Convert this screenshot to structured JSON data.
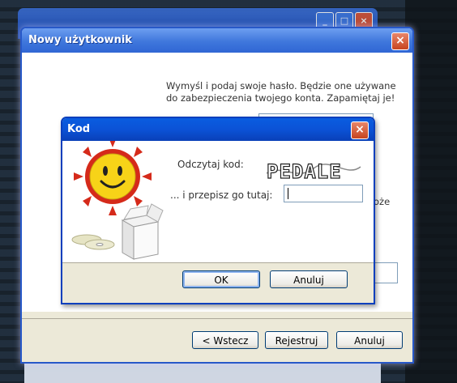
{
  "back_window": {
    "title": ""
  },
  "wizard": {
    "title": "Nowy użytkownik",
    "intro": "Wymyśl i podaj swoje hasło. Będzie one używane do zabezpieczenia twojego konta. Zapamiętaj je!",
    "partial_text_1": "oże",
    "partial_text_2": "e:",
    "back_label": "< Wstecz",
    "register_label": "Rejestruj",
    "cancel_label": "Anuluj"
  },
  "dialog": {
    "title": "Kod",
    "read_code_label": "Odczytaj kod:",
    "captcha_text": "PEDALE",
    "rewrite_label": "... i przepisz go tutaj:",
    "code_value": "",
    "ok_label": "OK",
    "cancel_label": "Anuluj"
  },
  "icons": [
    "sun-smiley-icon",
    "box-icon",
    "cd-icon",
    "close-icon",
    "minimize-icon",
    "maximize-icon"
  ],
  "colors": {
    "titlebar": "#0b52d6",
    "face": "#ece9d8",
    "sun": "#d52a1a",
    "smiley": "#f6d21a"
  }
}
